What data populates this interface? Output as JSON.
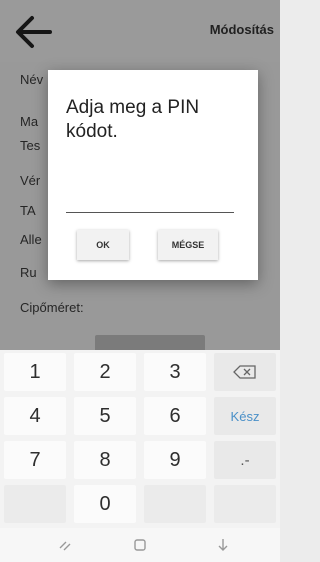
{
  "appbar": {
    "title": "Módosítás",
    "back_icon": "arrow-left-icon"
  },
  "form": {
    "fields": [
      "Név",
      "Ma",
      "Tes",
      "Vér",
      "TA",
      "Alle",
      "Ru"
    ],
    "shoe_size_label": "Cipőméret:"
  },
  "dialog": {
    "message": "Adja meg a PIN kódot.",
    "input_value": "",
    "ok_label": "OK",
    "cancel_label": "MÉGSE"
  },
  "keyboard": {
    "rows": [
      [
        "1",
        "2",
        "3",
        "backspace-icon"
      ],
      [
        "4",
        "5",
        "6",
        "Kész"
      ],
      [
        "7",
        "8",
        "9",
        ".-"
      ],
      [
        "",
        "0",
        "",
        ""
      ]
    ],
    "done_label": "Kész",
    "symbols_label": ".-"
  },
  "navbar": {
    "icons": [
      "recent-apps-icon",
      "home-icon",
      "back-down-icon"
    ]
  },
  "colors": {
    "accent": "#4a90c8",
    "scrim": "#000000"
  }
}
